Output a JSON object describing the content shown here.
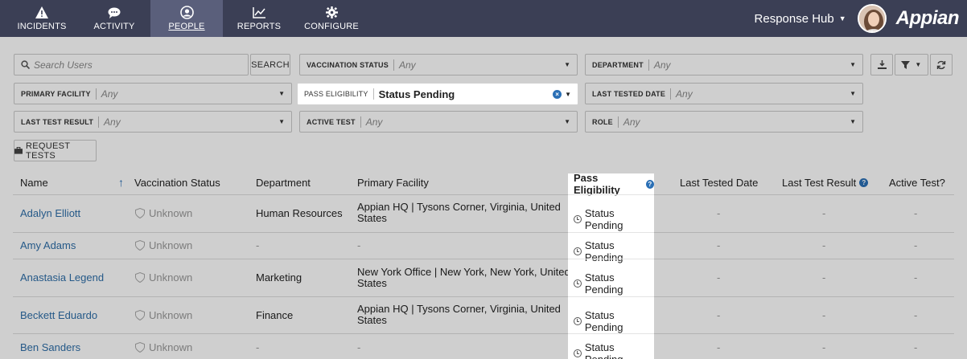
{
  "nav": {
    "items": [
      {
        "label": "INCIDENTS",
        "icon": "warning-icon"
      },
      {
        "label": "ACTIVITY",
        "icon": "chat-icon"
      },
      {
        "label": "PEOPLE",
        "icon": "person-icon"
      },
      {
        "label": "REPORTS",
        "icon": "chart-icon"
      },
      {
        "label": "CONFIGURE",
        "icon": "gear-icon"
      }
    ],
    "active": "PEOPLE",
    "hub_label": "Response Hub",
    "logo": "Appian"
  },
  "filters": {
    "search_placeholder": "Search Users",
    "search_button": "SEARCH",
    "vaccination_status": {
      "label": "VACCINATION STATUS",
      "value": "Any"
    },
    "department": {
      "label": "DEPARTMENT",
      "value": "Any"
    },
    "primary_facility": {
      "label": "PRIMARY FACILITY",
      "value": "Any"
    },
    "pass_eligibility": {
      "label": "PASS ELIGIBILITY",
      "value": "Status Pending"
    },
    "last_tested_date": {
      "label": "LAST TESTED DATE",
      "value": "Any"
    },
    "last_test_result": {
      "label": "LAST TEST RESULT",
      "value": "Any"
    },
    "active_test": {
      "label": "ACTIVE TEST",
      "value": "Any"
    },
    "role": {
      "label": "ROLE",
      "value": "Any"
    },
    "request_tests": "REQUEST TESTS"
  },
  "table": {
    "headers": [
      "Name",
      "Vaccination Status",
      "Department",
      "Primary Facility",
      "Pass Eligibility",
      "Last Tested Date",
      "Last Test Result",
      "Active Test?"
    ],
    "rows": [
      {
        "name": "Adalyn Elliott",
        "vaccination": "Unknown",
        "department": "Human Resources",
        "facility_line1": "Appian HQ | Tysons Corner, Virginia, United",
        "facility_line2": "States",
        "pass": "Status Pending",
        "last_tested": "-",
        "last_result": "-",
        "active": "-"
      },
      {
        "name": "Amy Adams",
        "vaccination": "Unknown",
        "department": "-",
        "facility_line1": "-",
        "facility_line2": "",
        "pass": "Status Pending",
        "last_tested": "-",
        "last_result": "-",
        "active": "-"
      },
      {
        "name": "Anastasia Legend",
        "vaccination": "Unknown",
        "department": "Marketing",
        "facility_line1": "New York Office | New York, New York, United",
        "facility_line2": "States",
        "pass": "Status Pending",
        "last_tested": "-",
        "last_result": "-",
        "active": "-"
      },
      {
        "name": "Beckett Eduardo",
        "vaccination": "Unknown",
        "department": "Finance",
        "facility_line1": "Appian HQ | Tysons Corner, Virginia, United",
        "facility_line2": "States",
        "pass": "Status Pending",
        "last_tested": "-",
        "last_result": "-",
        "active": "-"
      },
      {
        "name": "Ben Sanders",
        "vaccination": "Unknown",
        "department": "-",
        "facility_line1": "-",
        "facility_line2": "",
        "pass": "Status Pending",
        "last_tested": "-",
        "last_result": "-",
        "active": "-"
      }
    ]
  },
  "colors": {
    "nav_bg": "#3b3f55",
    "nav_active": "#5a5f7b",
    "link": "#2e6ea8",
    "help_icon": "#2a6fb5"
  }
}
